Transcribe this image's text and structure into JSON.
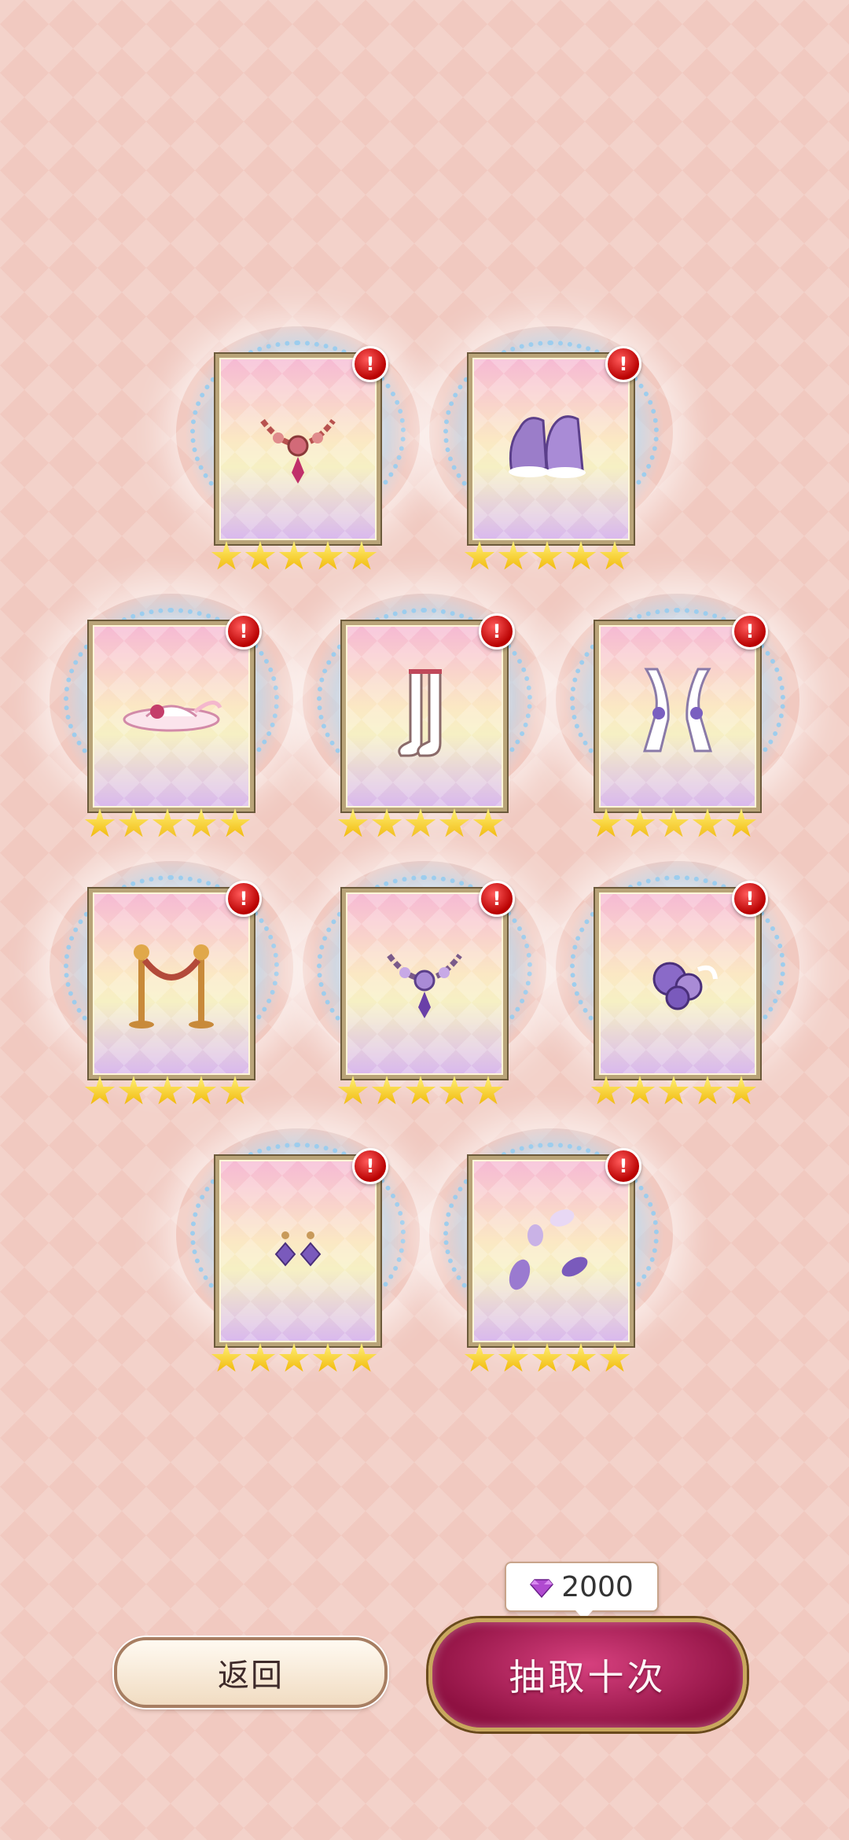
{
  "items": [
    {
      "name": "crown-necklace",
      "stars": 5,
      "badge": "!"
    },
    {
      "name": "mary-jane-shoes",
      "stars": 5,
      "badge": "!"
    },
    {
      "name": "rose-hat",
      "stars": 5,
      "badge": "!"
    },
    {
      "name": "white-stockings",
      "stars": 5,
      "badge": "!"
    },
    {
      "name": "lace-gloves",
      "stars": 5,
      "badge": "!"
    },
    {
      "name": "rope-barrier",
      "stars": 5,
      "badge": "!"
    },
    {
      "name": "amethyst-necklace",
      "stars": 5,
      "badge": "!"
    },
    {
      "name": "rose-hair-clip",
      "stars": 5,
      "badge": "!"
    },
    {
      "name": "diamond-earrings",
      "stars": 5,
      "badge": "!"
    },
    {
      "name": "petals-effect",
      "stars": 5,
      "badge": "!"
    }
  ],
  "cost": {
    "icon": "gem-icon",
    "value": "2000"
  },
  "buttons": {
    "back": "返回",
    "draw": "抽取十次"
  },
  "colors": {
    "star": "#f5c400",
    "badge": "#c00000",
    "draw_button": "#b02060"
  }
}
